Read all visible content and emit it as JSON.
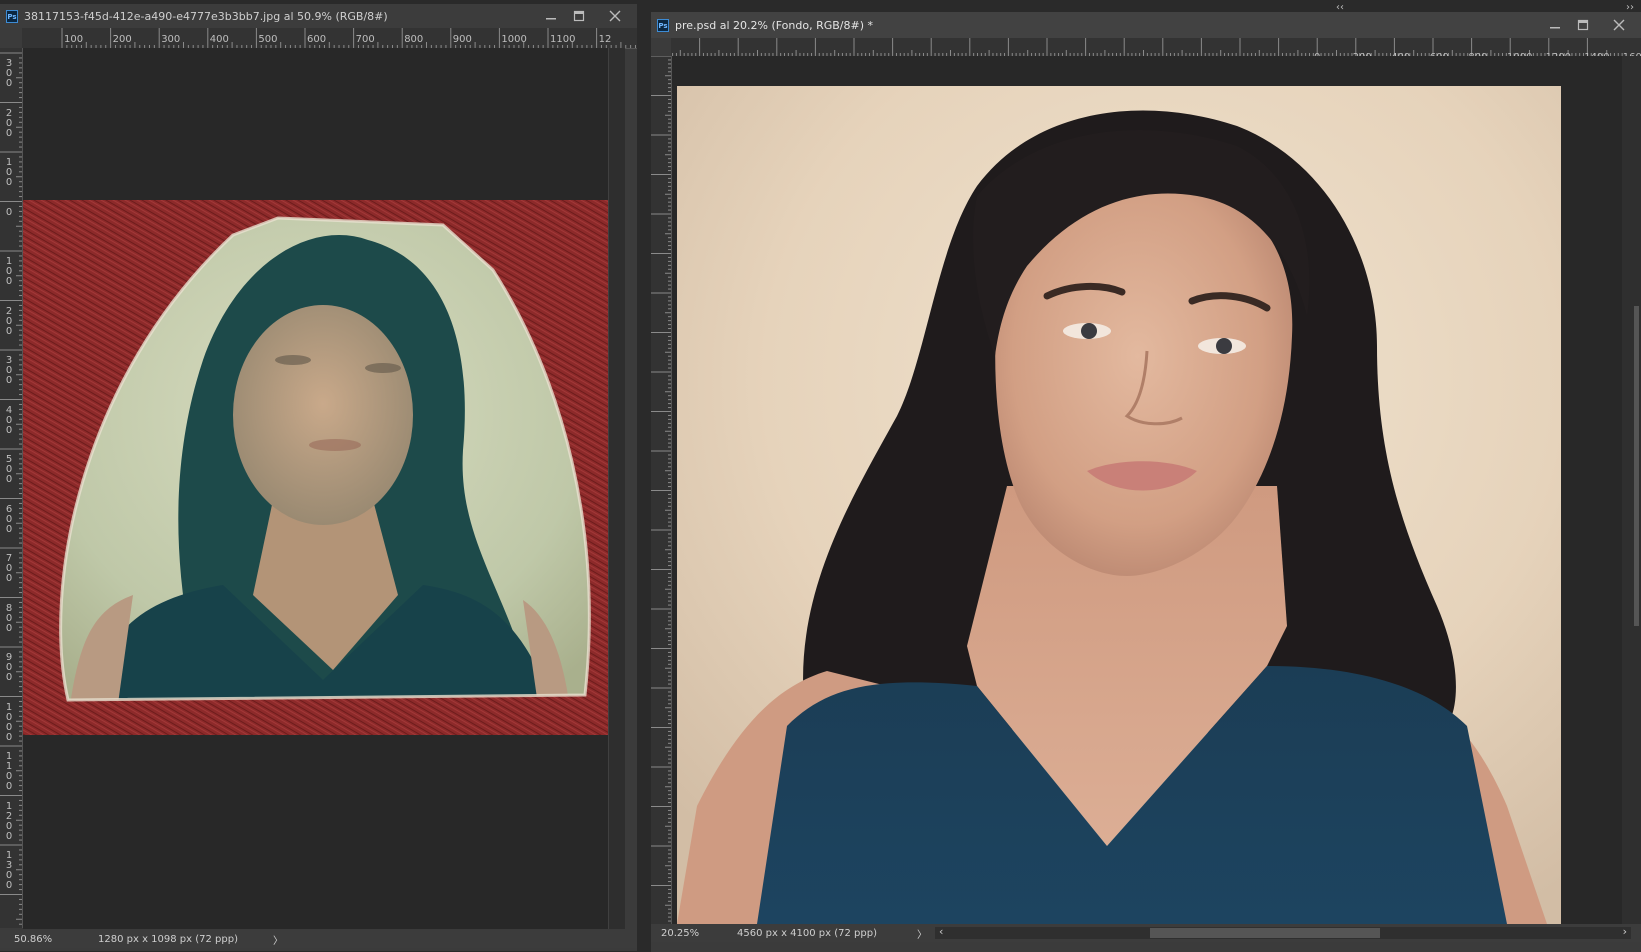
{
  "app": {
    "top_right_collapse": "‹‹",
    "top_right_arrows": "››"
  },
  "doc_left": {
    "title": "38117153-f45d-412e-a490-e4777e3b3bb7.jpg al 50.9% (RGB/8#)",
    "ps_badge": "Ps",
    "ruler_h_labels": [
      "100",
      "200",
      "300",
      "400",
      "500",
      "600",
      "700",
      "800",
      "900",
      "1000",
      "1100",
      "12"
    ],
    "ruler_v_labels": [
      "3\n0\n0",
      "2\n0\n0",
      "1\n0\n0",
      "0",
      "1\n0\n0",
      "2\n0\n0",
      "3\n0\n0",
      "4\n0\n0",
      "5\n0\n0",
      "6\n0\n0",
      "7\n0\n0",
      "8\n0\n0",
      "9\n0\n0",
      "1\n0\n0\n0",
      "1\n1\n0\n0",
      "1\n2\n0\n0",
      "1\n3\n0\n0"
    ],
    "zoom": "50.86%",
    "doc_size": "1280 px x 1098 px (72 ppp)",
    "status_arrow": "〉"
  },
  "doc_right": {
    "title": "pre.psd al 20.2% (Fondo, RGB/8#) *",
    "ps_badge": "Ps",
    "ruler_h_labels": [
      "0",
      "200",
      "400",
      "600",
      "800",
      "1000",
      "1200",
      "1400",
      "1600",
      "1800",
      "2000",
      "2200",
      "2400",
      "2600",
      "2800",
      "3000",
      "3200",
      "3400",
      "3600",
      "3800",
      "4000",
      "4200",
      "4400",
      "46"
    ],
    "ruler_v_labels": [
      "0\n0",
      "0",
      "2\n0\n0",
      "4\n0\n0",
      "6\n0\n0",
      "8\n0\n0",
      "1\n0\n0\n0",
      "1\n2\n0\n0",
      "1\n4\n0\n0",
      "1\n6\n0\n0",
      "1\n8\n0\n0",
      "2\n0\n0\n0",
      "2\n2\n0\n0",
      "2\n4\n0\n0",
      "2\n6\n0\n0",
      "2\n8\n0\n0",
      "3\n0\n0\n0",
      "3\n2\n0\n0",
      "3\n4\n0\n0",
      "3\n6\n0\n0",
      "3\n8\n0\n0",
      "4\n0\n0\n0"
    ],
    "zoom": "20.25%",
    "doc_size": "4560 px x 4100 px (72 ppp)",
    "status_arrow": "〉",
    "scroll_left_arrow": "‹",
    "scroll_right_arrow": "›"
  },
  "colors": {
    "accent": "#3d8bd4",
    "bg": "#2a2a2a",
    "panel": "#3c3c3c"
  }
}
